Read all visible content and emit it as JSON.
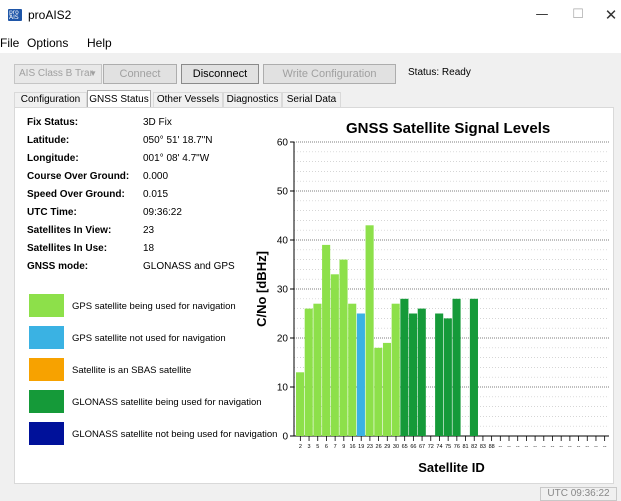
{
  "window": {
    "title": "proAIS2",
    "icon_text": "pro AIS"
  },
  "menu": {
    "items": [
      "File",
      "Options",
      "Help"
    ]
  },
  "toolbar": {
    "device_select": "AIS Class B Trar",
    "connect_label": "Connect",
    "disconnect_label": "Disconnect",
    "write_label": "Write Configuration",
    "status": "Status: Ready"
  },
  "tabs": [
    "Configuration",
    "GNSS Status",
    "Other Vessels",
    "Diagnostics",
    "Serial Data"
  ],
  "active_tab": "GNSS Status",
  "gnss_info": [
    {
      "label": "Fix Status:",
      "value": "3D Fix"
    },
    {
      "label": "Latitude:",
      "value": "050° 51' 18.7\"N"
    },
    {
      "label": "Longitude:",
      "value": "001° 08' 4.7\"W"
    },
    {
      "label": "Course Over Ground:",
      "value": "0.000"
    },
    {
      "label": "Speed Over Ground:",
      "value": "0.015"
    },
    {
      "label": "UTC Time:",
      "value": "09:36:22"
    },
    {
      "label": "Satellites In View:",
      "value": "23"
    },
    {
      "label": "Satellites In Use:",
      "value": "18"
    },
    {
      "label": "GNSS mode:",
      "value": "GLONASS and GPS"
    }
  ],
  "legend": [
    {
      "color": "#8de04a",
      "text": "GPS satellite being used for navigation"
    },
    {
      "color": "#3ab2e3",
      "text": "GPS satellite not used for navigation"
    },
    {
      "color": "#f7a200",
      "text": "Satellite is an SBAS satellite"
    },
    {
      "color": "#159a39",
      "text": "GLONASS satellite being used for navigation"
    },
    {
      "color": "#00119a",
      "text": "GLONASS satellite not being used for navigation"
    }
  ],
  "chart_data": {
    "type": "bar",
    "title": "GNSS Satellite Signal Levels",
    "xlabel": "Satellite ID",
    "ylabel": "C/No [dBHz]",
    "ylim": [
      0,
      60
    ],
    "yticks": [
      0,
      10,
      20,
      30,
      40,
      50,
      60
    ],
    "grid": true,
    "categories": [
      "2",
      "3",
      "5",
      "6",
      "7",
      "9",
      "16",
      "19",
      "23",
      "26",
      "29",
      "30",
      "65",
      "66",
      "67",
      "72",
      "74",
      "75",
      "76",
      "81",
      "82",
      "83",
      "88",
      "--",
      "--",
      "--",
      "--",
      "--",
      "--",
      "--",
      "--",
      "--",
      "--",
      "--",
      "--",
      "--"
    ],
    "values": [
      13,
      26,
      27,
      39,
      33,
      36,
      27,
      25,
      43,
      18,
      19,
      27,
      28,
      25,
      26,
      0,
      25,
      24,
      28,
      0,
      28,
      0,
      0,
      0,
      0,
      0,
      0,
      0,
      0,
      0,
      0,
      0,
      0,
      0,
      0,
      0
    ],
    "colors": [
      "#8de04a",
      "#8de04a",
      "#8de04a",
      "#8de04a",
      "#8de04a",
      "#8de04a",
      "#8de04a",
      "#3ab2e3",
      "#8de04a",
      "#8de04a",
      "#8de04a",
      "#8de04a",
      "#159a39",
      "#159a39",
      "#159a39",
      "#159a39",
      "#159a39",
      "#159a39",
      "#159a39",
      "#159a39",
      "#159a39",
      "#159a39",
      "#159a39",
      "#8de04a",
      "#8de04a",
      "#8de04a",
      "#8de04a",
      "#8de04a",
      "#8de04a",
      "#8de04a",
      "#8de04a",
      "#8de04a",
      "#8de04a",
      "#8de04a",
      "#8de04a",
      "#8de04a"
    ]
  },
  "statusbar": {
    "utc": "UTC 09:36:22"
  }
}
